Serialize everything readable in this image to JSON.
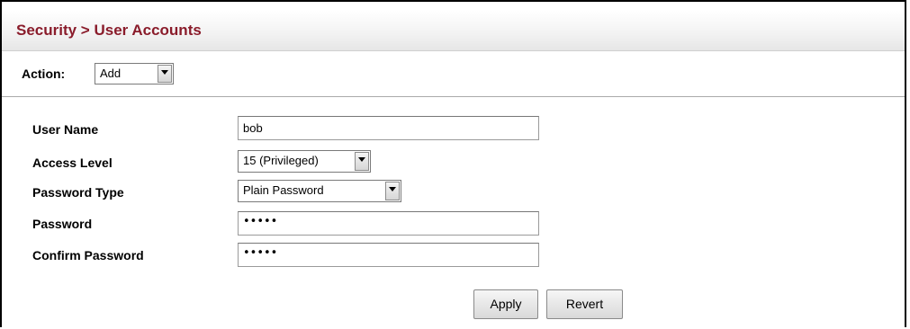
{
  "header": {
    "title": "Security > User Accounts"
  },
  "action": {
    "label": "Action:",
    "selected": "Add"
  },
  "form": {
    "user_name": {
      "label": "User Name",
      "value": "bob"
    },
    "access_level": {
      "label": "Access Level",
      "value": "15 (Privileged)"
    },
    "password_type": {
      "label": "Password Type",
      "value": "Plain Password"
    },
    "password": {
      "label": "Password",
      "masked": "•••••"
    },
    "confirm_password": {
      "label": "Confirm Password",
      "masked": "•••••"
    }
  },
  "buttons": {
    "apply": "Apply",
    "revert": "Revert"
  },
  "colors": {
    "title": "#8a1c2b",
    "border": "#000000"
  }
}
